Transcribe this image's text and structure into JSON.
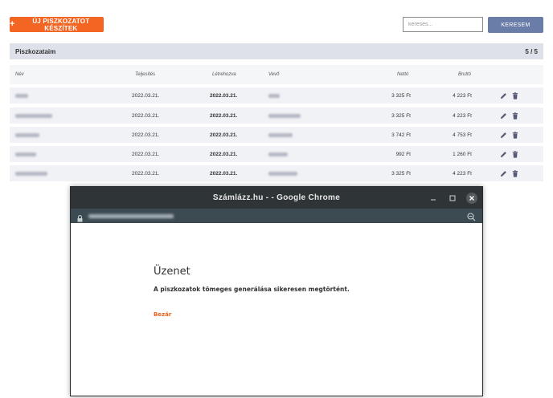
{
  "toolbar": {
    "new_button_label": "ÚJ PISZKOZATOT KÉSZÍTEK",
    "search_placeholder": "keresés...",
    "search_button_label": "KERESEM"
  },
  "list": {
    "title": "Piszkozataim",
    "count": "5 / 5",
    "columns": {
      "name": "Név",
      "completion": "Teljesítés",
      "created": "Létrehozva",
      "buyer": "Vevő",
      "net": "Nettó",
      "gross": "Bruttó"
    },
    "rows": [
      {
        "completion": "2022.03.21.",
        "created": "2022.03.21.",
        "net": "3 325 Ft",
        "gross": "4 223 Ft"
      },
      {
        "completion": "2022.03.21.",
        "created": "2022.03.21.",
        "net": "3 325 Ft",
        "gross": "4 223 Ft"
      },
      {
        "completion": "2022.03.21.",
        "created": "2022.03.21.",
        "net": "3 742 Ft",
        "gross": "4 753 Ft"
      },
      {
        "completion": "2022.03.21.",
        "created": "2022.03.21.",
        "net": "992 Ft",
        "gross": "1 260 Ft"
      },
      {
        "completion": "2022.03.21.",
        "created": "2022.03.21.",
        "net": "3 325 Ft",
        "gross": "4 223 Ft"
      }
    ]
  },
  "popup": {
    "window_title": "Számlázz.hu - - Google Chrome",
    "heading": "Üzenet",
    "message": "A piszkozatok tömeges generálása sikeresen megtörtént.",
    "close_link": "Bezár"
  },
  "colors": {
    "accent_orange": "#f26522",
    "search_button": "#6a7ca8",
    "action_icons": "#555a78"
  },
  "icons": [
    "plus-icon",
    "pencil-icon",
    "trash-icon",
    "lock-icon",
    "zoom-icon",
    "minimize-icon",
    "maximize-icon",
    "close-icon"
  ]
}
